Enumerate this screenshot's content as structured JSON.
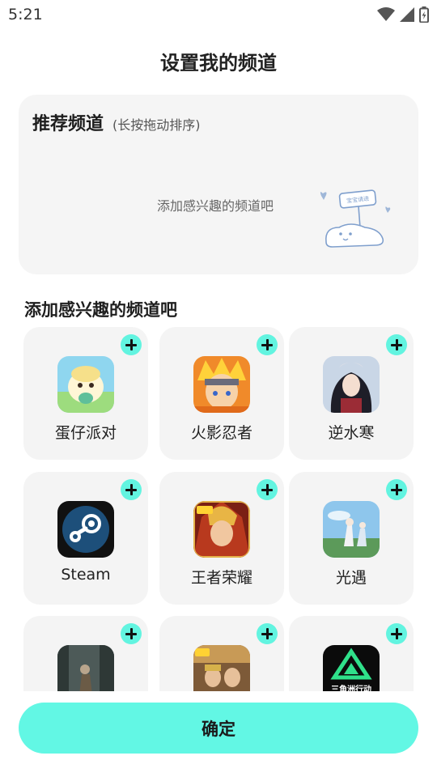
{
  "status_bar": {
    "time": "5:21",
    "icons": [
      "wifi-icon",
      "cell-signal-icon",
      "battery-icon"
    ]
  },
  "page": {
    "title": "设置我的频道"
  },
  "recommended": {
    "title": "推荐频道",
    "hint": "(长按拖动排序)",
    "empty_text": "添加感兴趣的频道吧",
    "illustration_sign_text": "宝宝请进"
  },
  "add_section": {
    "title": "添加感兴趣的频道吧",
    "channels": [
      {
        "label": "蛋仔派对",
        "icon": "eggy-party-icon"
      },
      {
        "label": "火影忍者",
        "icon": "naruto-icon"
      },
      {
        "label": "逆水寒",
        "icon": "nishuihan-icon"
      },
      {
        "label": "Steam",
        "icon": "steam-icon"
      },
      {
        "label": "王者荣耀",
        "icon": "honor-of-kings-icon"
      },
      {
        "label": "光遇",
        "icon": "sky-icon"
      },
      {
        "label": "",
        "icon": "forest-game-icon"
      },
      {
        "label": "",
        "icon": "peace-elite-icon"
      },
      {
        "label": "",
        "icon": "delta-force-icon",
        "icon_text": "三角洲行动"
      }
    ]
  },
  "confirm_button": {
    "label": "确定"
  },
  "colors": {
    "accent": "#62f4e0",
    "card_bg": "#f5f5f5",
    "tile_bg": "#f4f4f4"
  }
}
